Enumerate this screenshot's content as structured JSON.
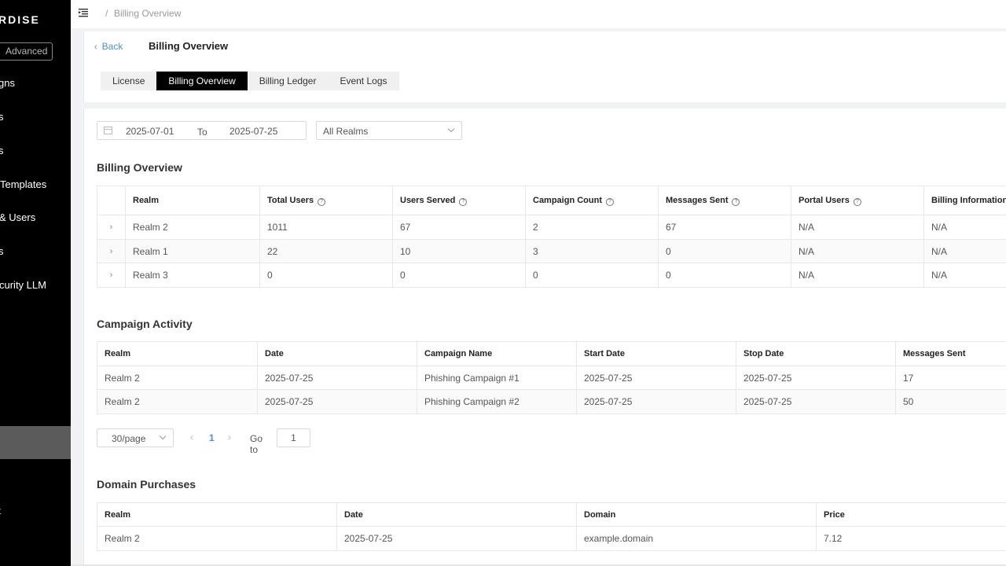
{
  "sidebar": {
    "brand": "RDISE",
    "mode_button": "Advanced",
    "items": [
      {
        "label": "gns"
      },
      {
        "label": "s"
      },
      {
        "label": "s"
      },
      {
        "label": "Templates"
      },
      {
        "label": "& Users"
      },
      {
        "label": "s"
      },
      {
        "label": "curity LLM"
      }
    ],
    "stray_glyph": "t"
  },
  "breadcrumb": {
    "separator": "/",
    "current": "Billing Overview"
  },
  "header": {
    "back_label": "Back",
    "title": "Billing Overview",
    "tabs": [
      {
        "label": "License",
        "active": false
      },
      {
        "label": "Billing Overview",
        "active": true
      },
      {
        "label": "Billing Ledger",
        "active": false
      },
      {
        "label": "Event Logs",
        "active": false
      }
    ]
  },
  "filters": {
    "start_date": "2025-07-01",
    "to_label": "To",
    "end_date": "2025-07-25",
    "realm_select": "All Realms"
  },
  "billing": {
    "title": "Billing Overview",
    "columns": [
      "Realm",
      "Total Users",
      "Users Served",
      "Campaign Count",
      "Messages Sent",
      "Portal Users",
      "Billing Information"
    ],
    "rows": [
      [
        "Realm 2",
        "1011",
        "67",
        "2",
        "67",
        "N/A",
        "N/A"
      ],
      [
        "Realm 1",
        "22",
        "10",
        "3",
        "0",
        "N/A",
        "N/A"
      ],
      [
        "Realm 3",
        "0",
        "0",
        "0",
        "0",
        "N/A",
        "N/A"
      ]
    ]
  },
  "campaign": {
    "title": "Campaign Activity",
    "columns": [
      "Realm",
      "Date",
      "Campaign Name",
      "Start Date",
      "Stop Date",
      "Messages Sent"
    ],
    "rows": [
      [
        "Realm 2",
        "2025-07-25",
        "Phishing Campaign #1",
        "2025-07-25",
        "2025-07-25",
        "17"
      ],
      [
        "Realm 2",
        "2025-07-25",
        "Phishing Campaign #2",
        "2025-07-25",
        "2025-07-25",
        "50"
      ]
    ]
  },
  "pagination": {
    "page_size": "30/page",
    "current_page": "1",
    "goto_label": "Go to",
    "goto_value": "1"
  },
  "domains": {
    "title": "Domain Purchases",
    "columns": [
      "Realm",
      "Date",
      "Domain",
      "Price"
    ],
    "rows": [
      [
        "Realm 2",
        "2025-07-25",
        "example.domain",
        "7.12"
      ]
    ]
  }
}
